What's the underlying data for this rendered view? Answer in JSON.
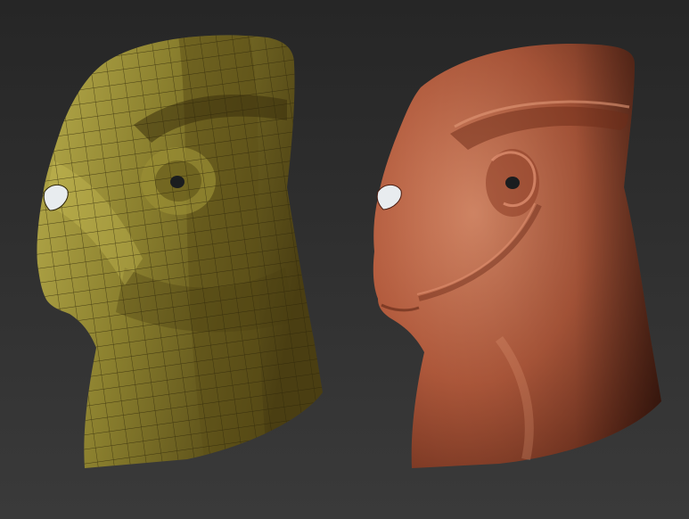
{
  "scene": {
    "background_top": "#262626",
    "background_bottom": "#3a3a3a",
    "models": [
      {
        "id": "lowpoly",
        "material": "wireframe-polygroup",
        "base_color": "#8a7f2e",
        "light_color": "#b8ad4c",
        "dark_color": "#4a3e12",
        "wire_color": "#2c2408"
      },
      {
        "id": "sculpted",
        "material": "smooth-clay",
        "base_color": "#b25a3c",
        "light_color": "#d98a68",
        "dark_color": "#5e2616"
      }
    ],
    "eye_color": "#e8ecef",
    "ear_hole_color": "#1b1d1f"
  }
}
